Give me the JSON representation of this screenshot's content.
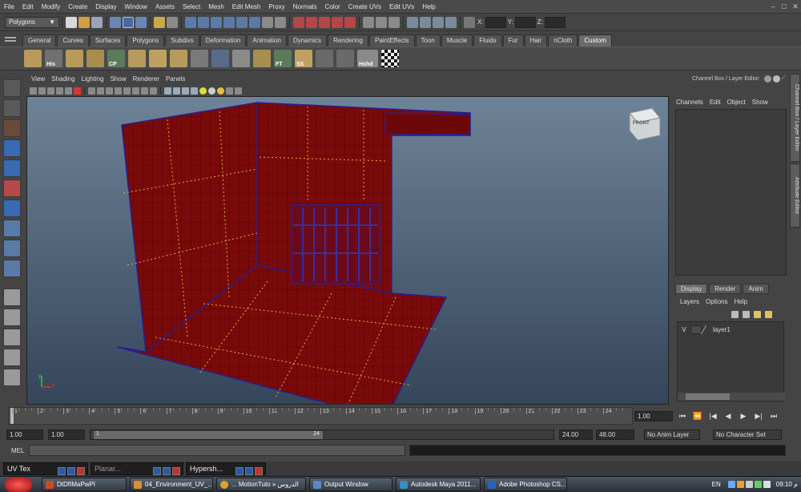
{
  "menubar": {
    "items": [
      "File",
      "Edit",
      "Modify",
      "Create",
      "Display",
      "Window",
      "Assets",
      "Select",
      "Mesh",
      "Edit Mesh",
      "Proxy",
      "Normals",
      "Color",
      "Create UVs",
      "Edit UVs",
      "Help"
    ]
  },
  "statusline": {
    "mode_select": "Polygons",
    "x_label": "X:",
    "y_label": "Y:",
    "z_label": "Z:"
  },
  "shelf": {
    "tabs": [
      "General",
      "Curves",
      "Surfaces",
      "Polygons",
      "Subdivs",
      "Deformation",
      "Animation",
      "Dynamics",
      "Rendering",
      "PaintEffects",
      "Toon",
      "Muscle",
      "Fluids",
      "Fur",
      "Hair",
      "nCloth",
      "Custom"
    ],
    "active_tab": "Custom",
    "icon_labels": {
      "his": "His",
      "cp": "CP",
      "ft": "FT",
      "ss": "SS",
      "hshd": "Hshd"
    }
  },
  "viewport": {
    "menu": [
      "View",
      "Shading",
      "Lighting",
      "Show",
      "Renderer",
      "Panels"
    ],
    "viewcube_label": "FRONT",
    "axis_y": "y",
    "axis_x": "x"
  },
  "channelbox": {
    "header": "Channel Box / Layer Editor",
    "menu": [
      "Channels",
      "Edit",
      "Object",
      "Show"
    ]
  },
  "sidetabs": [
    "Channel Box / Layer Editor",
    "Attribute Editor"
  ],
  "layers": {
    "tabs": [
      "Display",
      "Render",
      "Anim"
    ],
    "active_tab": "Display",
    "menu": [
      "Layers",
      "Options",
      "Help"
    ],
    "rows": [
      {
        "visible": "V",
        "name": "layer1"
      }
    ]
  },
  "timeline": {
    "ticks": [
      "1",
      "2",
      "3",
      "4",
      "5",
      "6",
      "7",
      "8",
      "9",
      "10",
      "11",
      "12",
      "13",
      "14",
      "15",
      "16",
      "17",
      "18",
      "19",
      "20",
      "21",
      "22",
      "23",
      "24"
    ],
    "current_frame": "1.00"
  },
  "range": {
    "start": "1.00",
    "playback_start": "1.00",
    "slider_start": "1",
    "slider_end": "24",
    "playback_end": "24.00",
    "end": "48.00",
    "anim_layer": "No Anim Layer",
    "character_set": "No Character Set"
  },
  "cmdline": {
    "label": "MEL"
  },
  "minimized_windows": [
    {
      "label": "UV Tex"
    },
    {
      "label": "Planar..."
    },
    {
      "label": "Hypersh..."
    }
  ],
  "taskbar": {
    "tasks": [
      {
        "label": "DtDfIMaPwPI",
        "color": "#c84a2a"
      },
      {
        "label": "04_Environment_UV_...",
        "color": "#d89030"
      },
      {
        "label": "... MotionTuto » الدروس",
        "color": "#e0a030"
      },
      {
        "label": "Output Window",
        "color": "#5a87c8"
      },
      {
        "label": "Autodesk Maya 2011...",
        "color": "#3a8ec0"
      },
      {
        "label": "Adobe Photoshop CS...",
        "color": "#2a64b8"
      }
    ],
    "lang": "EN",
    "time": "09:10 م"
  },
  "colors": {
    "wall_red": "#7a0a0a",
    "edge_blue": "#3a2ea0",
    "uv_yellow": "#d6b040"
  }
}
